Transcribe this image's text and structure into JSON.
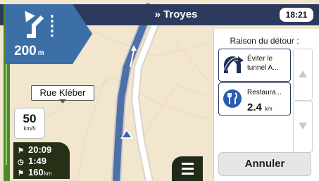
{
  "header": {
    "destination": "» Troyes",
    "clock": "18:21"
  },
  "maneuver": {
    "distance_value": "200",
    "distance_unit": "m",
    "icon": "keep-left-arrow-icon"
  },
  "street_label": "Rue Kléber",
  "speed_limit": {
    "value": "50",
    "unit": "km/h"
  },
  "trip_info": {
    "arrival_time": "20:09",
    "remaining_time": "1:49",
    "remaining_distance_value": "160",
    "remaining_distance_unit": "km"
  },
  "detour_panel": {
    "title": "Raison du détour :",
    "options": [
      {
        "line1": "Éviter le",
        "line2": "tunnel A...",
        "icon": "tunnel-avoid-icon"
      },
      {
        "line1": "Restaura...",
        "distance_value": "2.4",
        "distance_unit": "km",
        "icon": "restaurant-icon"
      }
    ],
    "cancel_label": "Annuler"
  },
  "colors": {
    "header": "#2c3a5e",
    "route": "#4f6fa8",
    "map_bg": "#f2e6cf",
    "trip_bg": "#263016"
  }
}
